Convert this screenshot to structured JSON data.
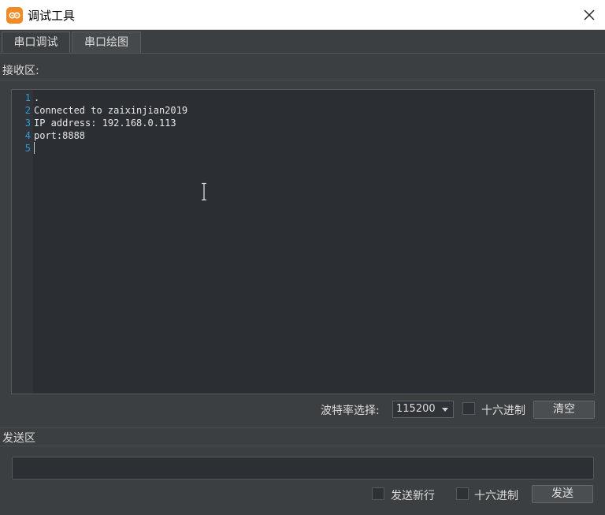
{
  "window": {
    "title": "调试工具",
    "close_icon": "close-icon"
  },
  "tabs": [
    {
      "label": "串口调试",
      "active": true
    },
    {
      "label": "串口绘图",
      "active": false
    }
  ],
  "receive": {
    "label": "接收区:",
    "line_numbers": [
      "1",
      "2",
      "3",
      "4",
      "5"
    ],
    "lines": [
      ".",
      "Connected to zaixinjian2019",
      "IP address: 192.168.0.113",
      "port:8888",
      ""
    ]
  },
  "controls": {
    "baud_label": "波特率选择:",
    "baud_value": "115200",
    "hex_label": "十六进制",
    "clear_label": "清空"
  },
  "send": {
    "label": "发送区",
    "input_value": "",
    "newline_label": "发送新行",
    "hex_label": "十六进制",
    "send_label": "发送"
  },
  "colors": {
    "accent": "#f08a24",
    "line_number": "#2e9bd8"
  }
}
